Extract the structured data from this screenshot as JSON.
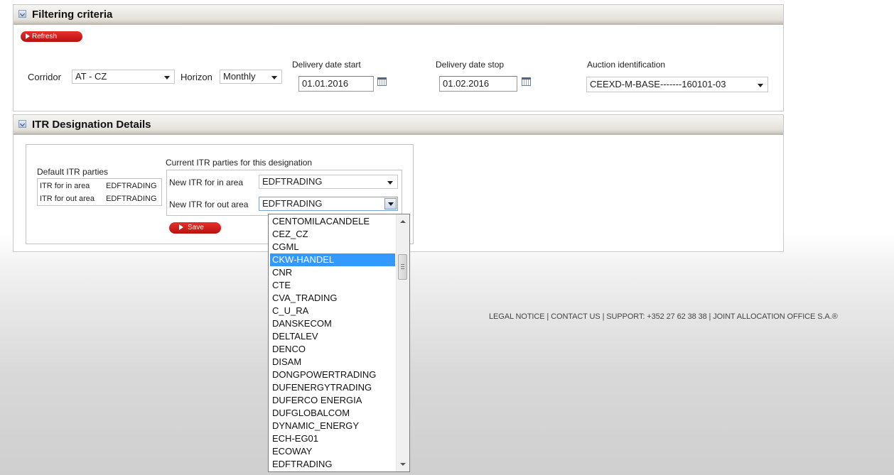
{
  "filtering": {
    "title": "Filtering criteria",
    "refresh_label": "Refresh",
    "corridor_label": "Corridor",
    "corridor_value": "AT - CZ",
    "horizon_label": "Horizon",
    "horizon_value": "Monthly",
    "delivery_start_label": "Delivery date start",
    "delivery_start_value": "01.01.2016",
    "delivery_stop_label": "Delivery date stop",
    "delivery_stop_value": "01.02.2016",
    "auction_label": "Auction identification",
    "auction_value": "CEEXD-M-BASE-------160101-03"
  },
  "itr": {
    "title": "ITR Designation Details",
    "default_parties_label": "Default ITR parties",
    "default_in_label": "ITR for in area",
    "default_in_value": "EDFTRADING",
    "default_out_label": "ITR for out area",
    "default_out_value": "EDFTRADING",
    "current_parties_label": "Current ITR parties for this designation",
    "new_in_label": "New ITR for in area",
    "new_in_value": "EDFTRADING",
    "new_out_label": "New ITR for out area",
    "new_out_value": "EDFTRADING",
    "save_label": "Save"
  },
  "dropdown": {
    "selected_index": 3,
    "options": [
      "CENTOMILACANDELE",
      "CEZ_CZ",
      "CGML",
      "CKW-HANDEL",
      "CNR",
      "CTE",
      "CVA_TRADING",
      "C_U_RA",
      "DANSKECOM",
      "DELTALEV",
      "DENCO",
      "DISAM",
      "DONGPOWERTRADING",
      "DUFENERGYTRADING",
      "DUFERCO ENERGIA",
      "DUFGLOBALCOM",
      "DYNAMIC_ENERGY",
      "ECH-EG01",
      "ECOWAY",
      "EDFTRADING"
    ]
  },
  "footer": {
    "text": "LEGAL NOTICE | CONTACT US | SUPPORT: +352 27 62 38 38 | JOINT ALLOCATION OFFICE S.A.®"
  }
}
